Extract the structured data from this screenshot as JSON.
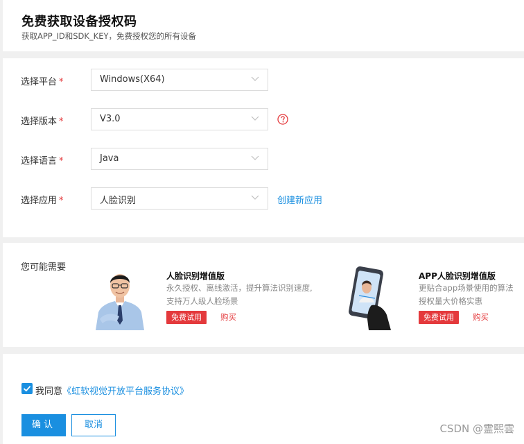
{
  "header": {
    "title": "免费获取设备授权码",
    "subtitle": "获取APP_ID和SDK_KEY，免费授权您的所有设备"
  },
  "form": {
    "platform": {
      "label": "选择平台",
      "value": "Windows(X64)"
    },
    "version": {
      "label": "选择版本",
      "value": "V3.0"
    },
    "language": {
      "label": "选择语言",
      "value": "Java"
    },
    "app": {
      "label": "选择应用",
      "value": "人脸识别"
    },
    "create_app_link": "创建新应用",
    "required_mark": "*"
  },
  "recommend": {
    "label": "您可能需要",
    "products": [
      {
        "title": "人脸识别增值版",
        "desc1": "永久授权、离线激活，提升算法识别速度,",
        "desc2": "支持万人级人脸场景",
        "trial": "免费试用",
        "buy": "购买"
      },
      {
        "title": "APP人脸识别增值版",
        "desc1": "更贴合app场景使用的算法",
        "desc2": "授权量大价格实惠",
        "trial": "免费试用",
        "buy": "购买"
      }
    ]
  },
  "agreement": {
    "checked": true,
    "prefix": "我同意",
    "link": "《虹软视觉开放平台服务协议》"
  },
  "actions": {
    "confirm": "确认",
    "cancel": "取消"
  },
  "watermark": "CSDN @霊熙雲",
  "colors": {
    "accent": "#1a8fe0",
    "danger": "#e4393c",
    "background": "#f0f0f0"
  }
}
